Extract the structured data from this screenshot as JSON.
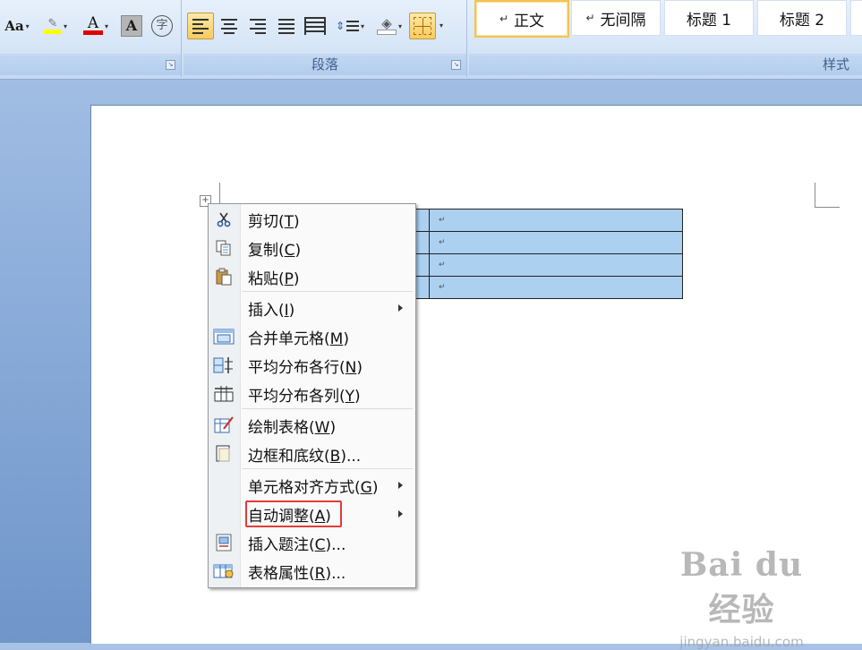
{
  "ribbon": {
    "font_group": {
      "change_case_label": "Aa",
      "font_color_letter": "A",
      "char_shading_letter": "A",
      "enclose_char": "字",
      "highlight_color": "#ffff00",
      "font_color": "#e00000"
    },
    "paragraph_group": {
      "label": "段落"
    },
    "styles_group": {
      "label": "样式",
      "items": [
        {
          "mark": "↵",
          "label": "正文",
          "selected": true
        },
        {
          "mark": "↵",
          "label": "无间隔",
          "selected": false
        },
        {
          "mark": "",
          "label": "标题 1",
          "selected": false
        },
        {
          "mark": "",
          "label": "标题 2",
          "selected": false
        }
      ]
    }
  },
  "table": {
    "paragraph_mark": "↵",
    "rows": 4
  },
  "context_menu": {
    "items": [
      {
        "label": "剪切(",
        "key": "T",
        "suffix": ")",
        "icon": "scissors-icon",
        "submenu": false
      },
      {
        "label": "复制(",
        "key": "C",
        "suffix": ")",
        "icon": "copy-icon",
        "submenu": false
      },
      {
        "label": "粘贴(",
        "key": "P",
        "suffix": ")",
        "icon": "paste-icon",
        "submenu": false
      },
      {
        "label": "插入(",
        "key": "I",
        "suffix": ")",
        "icon": "",
        "submenu": true
      },
      {
        "label": "合并单元格(",
        "key": "M",
        "suffix": ")",
        "icon": "merge-cells-icon",
        "submenu": false
      },
      {
        "label": "平均分布各行(",
        "key": "N",
        "suffix": ")",
        "icon": "distribute-rows-icon",
        "submenu": false
      },
      {
        "label": "平均分布各列(",
        "key": "Y",
        "suffix": ")",
        "icon": "distribute-columns-icon",
        "submenu": false
      },
      {
        "label": "绘制表格(",
        "key": "W",
        "suffix": ")",
        "icon": "draw-table-icon",
        "submenu": false
      },
      {
        "label": "边框和底纹(",
        "key": "B",
        "suffix": ")...",
        "icon": "borders-shading-icon",
        "submenu": false
      },
      {
        "label": "单元格对齐方式(",
        "key": "G",
        "suffix": ")",
        "icon": "",
        "submenu": true
      },
      {
        "label": "自动调整(",
        "key": "A",
        "suffix": ")",
        "icon": "",
        "submenu": true
      },
      {
        "label": "插入题注(",
        "key": "C",
        "suffix": ")...",
        "icon": "insert-caption-icon",
        "submenu": false
      },
      {
        "label": "表格属性(",
        "key": "R",
        "suffix": ")...",
        "icon": "table-properties-icon",
        "submenu": false
      }
    ]
  },
  "watermark": {
    "brand": "Bai du 经验",
    "url": "jingyan.baidu.com"
  }
}
